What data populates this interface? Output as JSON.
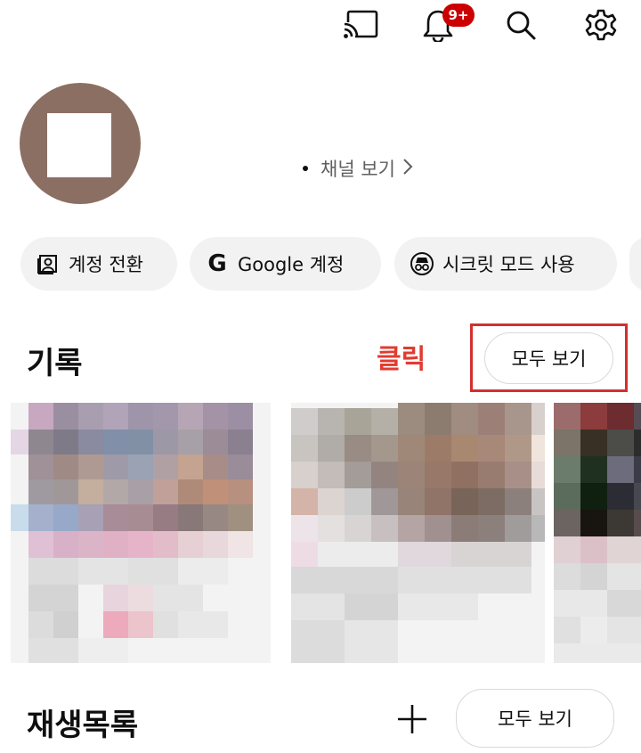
{
  "topbar": {
    "icons": [
      "cast-icon",
      "bell-icon",
      "search-icon",
      "settings-icon"
    ],
    "notification_badge": "9+"
  },
  "profile": {
    "channel_link": "채널 보기"
  },
  "chips": [
    {
      "label": "계정 전환",
      "icon": "account-switch-icon"
    },
    {
      "label": "Google 계정",
      "icon": "google-icon"
    },
    {
      "label": "시크릿 모드 사용",
      "icon": "incognito-icon"
    }
  ],
  "history": {
    "title": "기록",
    "annotation": "클릭",
    "view_all": "모두 보기"
  },
  "playlists": {
    "title": "재생목록",
    "view_all": "모두 보기"
  },
  "colors": {
    "badge": "#cc0000",
    "annotation": "#e03c31",
    "highlight_box": "#d32f2f",
    "chip_bg": "#f2f2f2",
    "avatar_bg": "#8c6f63"
  }
}
